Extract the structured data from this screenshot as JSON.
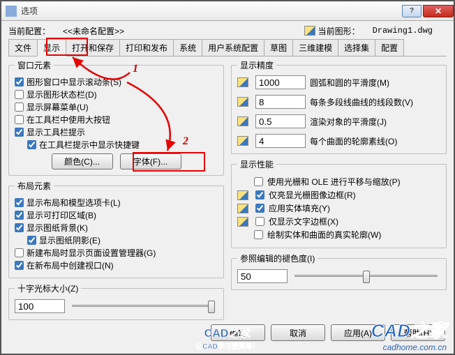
{
  "window": {
    "title": "选项"
  },
  "header": {
    "current_profile_label": "当前配置：",
    "current_profile_value": "<<未命名配置>>",
    "current_drawing_label": "当前图形：",
    "current_drawing_value": "Drawing1.dwg"
  },
  "tabs": [
    "文件",
    "显示",
    "打开和保存",
    "打印和发布",
    "系统",
    "用户系统配置",
    "草图",
    "三维建模",
    "选择集",
    "配置"
  ],
  "active_tab": 1,
  "window_elements": {
    "legend": "窗口元素",
    "items": [
      {
        "label": "图形窗口中显示滚动条(S)",
        "checked": true
      },
      {
        "label": "显示图形状态栏(D)",
        "checked": false
      },
      {
        "label": "显示屏幕菜单(U)",
        "checked": false
      },
      {
        "label": "在工具栏中使用大按钮",
        "checked": false
      },
      {
        "label": "显示工具栏提示",
        "checked": true
      },
      {
        "label": "在工具栏提示中显示快捷键",
        "checked": true
      }
    ],
    "indent_last": true,
    "color_btn": "颜色(C)...",
    "font_btn": "字体(F)..."
  },
  "layout_elements": {
    "legend": "布局元素",
    "items": [
      {
        "label": "显示布局和模型选项卡(L)",
        "checked": true
      },
      {
        "label": "显示可打印区域(B)",
        "checked": true
      },
      {
        "label": "显示图纸背景(K)",
        "checked": true
      },
      {
        "label": "显示图纸阴影(E)",
        "checked": true,
        "indent": true
      },
      {
        "label": "新建布局时显示页面设置管理器(G)",
        "checked": false
      },
      {
        "label": "在新布局中创建视口(N)",
        "checked": true
      }
    ]
  },
  "display_precision": {
    "legend": "显示精度",
    "rows": [
      {
        "value": "1000",
        "label": "圆弧和圆的平滑度(M)"
      },
      {
        "value": "8",
        "label": "每条多段线曲线的线段数(V)"
      },
      {
        "value": "0.5",
        "label": "渲染对象的平滑度(J)"
      },
      {
        "value": "4",
        "label": "每个曲面的轮廓素线(O)"
      }
    ]
  },
  "display_performance": {
    "legend": "显示性能",
    "items": [
      {
        "label": "使用光栅和 OLE 进行平移与缩放(P)",
        "checked": false,
        "icon": false
      },
      {
        "label": "仅亮显光栅图像边框(R)",
        "checked": true,
        "icon": true
      },
      {
        "label": "应用实体填充(Y)",
        "checked": true,
        "icon": true
      },
      {
        "label": "仅显示文字边框(X)",
        "checked": false,
        "icon": true
      },
      {
        "label": "绘制实体和曲面的真实轮廓(W)",
        "checked": false,
        "icon": false
      }
    ]
  },
  "crosshair": {
    "legend": "十字光标大小(Z)",
    "value": "100",
    "pos": 100
  },
  "refedit": {
    "legend": "参照编辑的褪色度(I)",
    "value": "50",
    "pos": 50
  },
  "buttons": {
    "ok": "确定",
    "cancel": "取消",
    "apply": "应用(A)",
    "help": "帮助(H)"
  },
  "callouts": {
    "n1": "1",
    "n2": "2"
  },
  "watermark": {
    "brand": "CAD之家",
    "url": "cadhome.com.cn",
    "sub": "让CAD学习更简单！",
    "url2": "HOME.COM.CN"
  }
}
